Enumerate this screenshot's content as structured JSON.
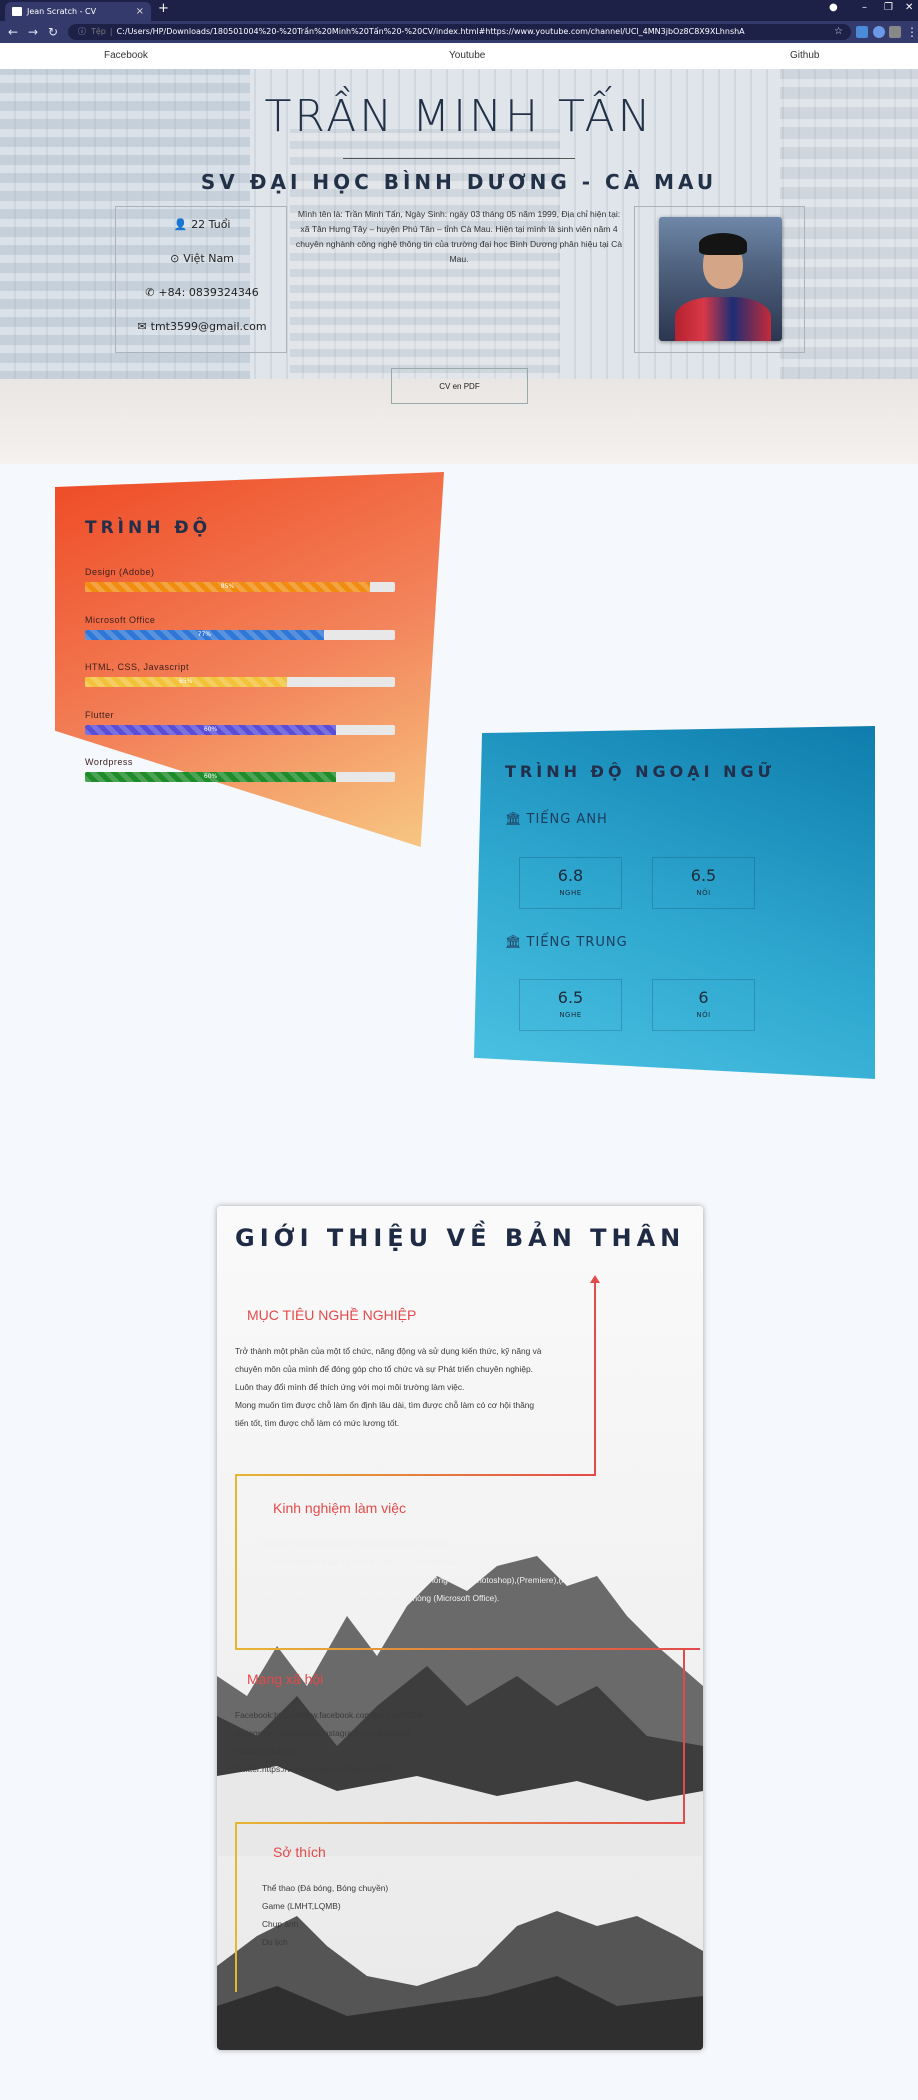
{
  "browser": {
    "tab_title": "Jean Scratch - CV",
    "tab_close": "×",
    "new_tab": "+",
    "secure_label": "Tệp",
    "url": "C:/Users/HP/Downloads/180501004%20-%20Trần%20Minh%20Tấn%20-%20CV/index.html#https://www.youtube.com/channel/UCl_4MN3jbOz8C8X9XLhnshA"
  },
  "nav": {
    "links": [
      "Facebook",
      "Youtube",
      "Github"
    ]
  },
  "hero": {
    "name": "TRẦN MINH TẤN",
    "subtitle": "SV ĐẠI HỌC BÌNH DƯƠNG - CÀ MAU",
    "age": "22 Tuổi",
    "country": "Việt Nam",
    "phone": "+84: 0839324346",
    "email": "tmt3599@gmail.com",
    "bio": "Mình tên là: Trần Minh Tấn, Ngày Sinh: ngày 03 tháng 05 năm 1999, Địa chỉ hiện tại: xã Tân Hưng Tây – huyện Phú Tân – tỉnh Cà Mau. Hiện tại mình là sinh viên năm 4 chuyên nghành công nghệ thông tin của trường đại học Bình Dương phân hiệu tại Cà Mau.",
    "pdf_button": "CV en PDF"
  },
  "skills": {
    "title": "TRÌNH ĐỘ",
    "items": [
      {
        "label": "Design (Adobe)",
        "value": 92,
        "text": "85%",
        "color": "#f08c0f"
      },
      {
        "label": "Microsoft Office",
        "value": 77,
        "text": "77%",
        "color": "#2f77d6"
      },
      {
        "label": "HTML, CSS, Javascript",
        "value": 65,
        "text": "65%",
        "color": "#f2c23a"
      },
      {
        "label": "Flutter",
        "value": 81,
        "text": "60%",
        "color": "#5a4ed6"
      },
      {
        "label": "Wordpress",
        "value": 81,
        "text": "60%",
        "color": "#1f8c2a"
      }
    ]
  },
  "languages": {
    "title": "TRÌNH ĐỘ NGOẠI NGỮ",
    "items": [
      {
        "name": "TIẾNG ANH",
        "listen": "6.8",
        "speak": "6.5"
      },
      {
        "name": "TIẾNG TRUNG",
        "listen": "6.5",
        "speak": "6"
      }
    ],
    "listen_label": "NGHE",
    "speak_label": "NÓI"
  },
  "about": {
    "title": "GIỚI THIỆU VỀ BẢN THÂN",
    "goal_title": "MỤC TIÊU NGHỀ NGHIỆP",
    "goal_lines": [
      "Trở thành một phần của một tổ chức, năng động và sử dụng kiến thức, kỹ năng và",
      "chuyên môn của mình để đóng góp cho tổ chức và sự Phát triển chuyên nghiệp.",
      "Luôn thay đổi mình để thích ứng với mọi môi trường làm việc.",
      "Mong muốn tìm được chỗ làm ổn định lâu dài, tìm được chỗ làm có cơ hội thăng",
      "tiến tốt, tìm được chỗ làm có mức lương tốt."
    ],
    "exp_title": "Kinh nghiệm làm việc",
    "exp_lines": [
      "Có kinh nghiệm lập trình mobile căng bản (Flutter).",
      "Có kinh nghiệm thiết kế web (HTML,CSS, Wordpress).",
      "Có kinh nghiệm về thiết kế Design, sử dụng thông thạo (Photoshop),(Premiere),(Ai).",
      "Sử dụng thông thạo các ứng dụng văn phòng (Microsoft Office)."
    ],
    "social_title": "Mạng xã hội",
    "social_lines": [
      "Facebook:https://www.facebook.com/minhtan3599.",
      "Instagram: https://www.instagram.com/tmt3599.",
      "Github: tmt3599.",
      "Twitter:https://www.twitter.com/trantan359."
    ],
    "hobby_title": "Sở thích",
    "hobby_lines": [
      "Thể thao (Đá bóng, Bóng chuyền)",
      "Game (LMHT,LQMB)",
      "Chụp ảnh",
      "Du lịch"
    ]
  },
  "colors": {
    "accent_red": "#e34a4a",
    "navy": "#1f2a45",
    "line_gold": "#e5b632"
  }
}
